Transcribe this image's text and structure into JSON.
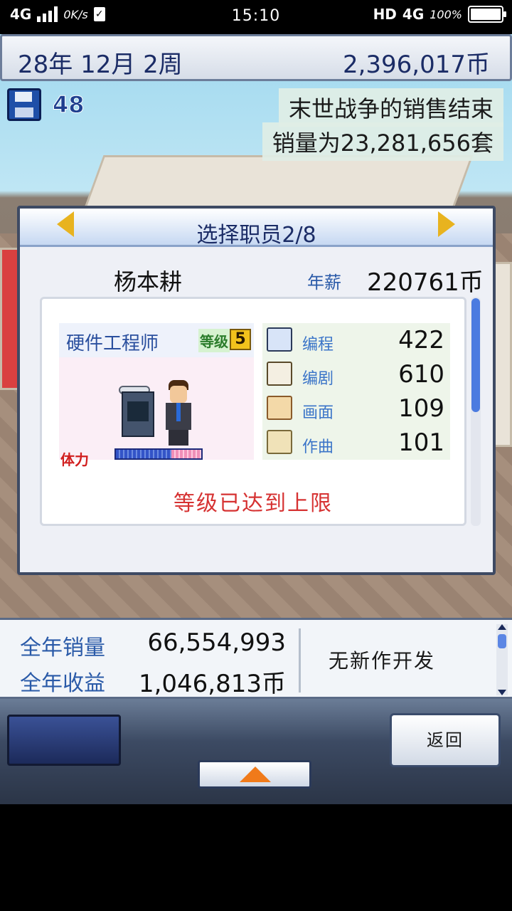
{
  "status_bar": {
    "network": "4G",
    "speed": "0K/s",
    "time": "15:10",
    "hd": "HD",
    "network_right": "4G",
    "battery_pct": "100%"
  },
  "header": {
    "date": "28年 12月 2周",
    "money": "2,396,017币"
  },
  "save": {
    "count": "48"
  },
  "notice": {
    "line1": "末世战争的销售结束",
    "line2": "销量为23,281,656套"
  },
  "dialog": {
    "title": "选择职员2/8",
    "employee_name": "杨本耕",
    "salary_label": "年薪",
    "salary_value": "220761币",
    "job_title": "硬件工程师",
    "level_label": "等级",
    "level_value": "5",
    "stamina_label": "体力",
    "stamina_fraction": 0.65,
    "stats": [
      {
        "icon": "computer-icon",
        "label": "编程",
        "value": "422"
      },
      {
        "icon": "book-icon",
        "label": "编剧",
        "value": "610"
      },
      {
        "icon": "paint-icon",
        "label": "画面",
        "value": "109"
      },
      {
        "icon": "music-icon",
        "label": "作曲",
        "value": "101"
      }
    ],
    "max_level_message": "等级已达到上限"
  },
  "bottom_info": {
    "annual_sales_label": "全年销量",
    "annual_sales_value": "66,554,993",
    "annual_revenue_label": "全年收益",
    "annual_revenue_value": "1,046,813币",
    "dev_status": "无新作开发"
  },
  "controls": {
    "back_label": "返回"
  },
  "colors": {
    "accent_blue": "#1b2c66",
    "label_blue": "#2a5aa8",
    "warning_red": "#d63232",
    "arrow_gold": "#e8b31f",
    "up_arrow_orange": "#f07a1a"
  }
}
